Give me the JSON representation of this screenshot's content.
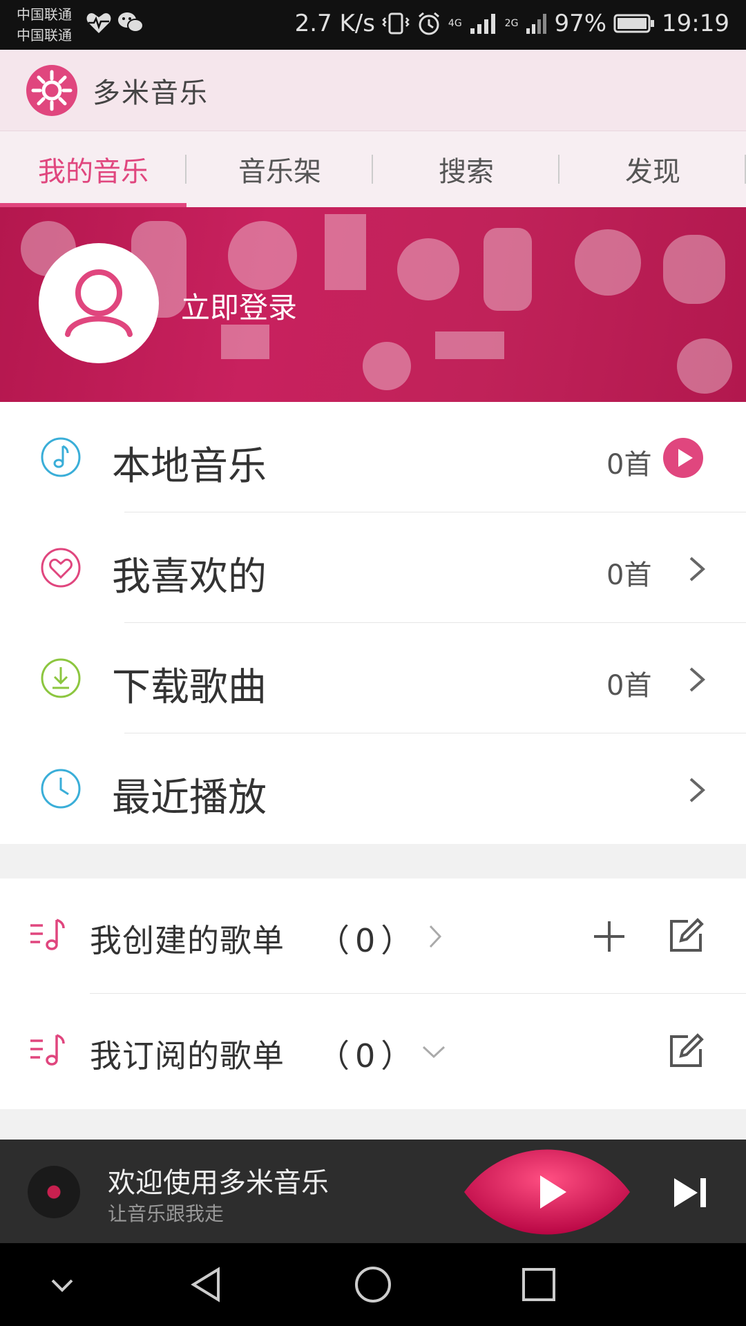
{
  "status_bar": {
    "carrier_1": "中国联通",
    "carrier_2": "中国联通",
    "net_speed": "2.7 K/s",
    "net_4g": "4G",
    "net_2g": "2G",
    "battery": "97%",
    "time": "19:19"
  },
  "app": {
    "title": "多米音乐",
    "accent_color": "#e0467e"
  },
  "tabs": [
    {
      "label": "我的音乐",
      "active": true
    },
    {
      "label": "音乐架",
      "active": false
    },
    {
      "label": "搜索",
      "active": false
    },
    {
      "label": "发现",
      "active": false
    }
  ],
  "banner": {
    "login_label": "立即登录"
  },
  "menu": [
    {
      "label": "本地音乐",
      "count": "0首",
      "icon": "music-note-icon",
      "action": "play-icon"
    },
    {
      "label": "我喜欢的",
      "count": "0首",
      "icon": "heart-icon",
      "action": "chevron-right-icon"
    },
    {
      "label": "下载歌曲",
      "count": "0首",
      "icon": "download-icon",
      "action": "chevron-right-icon"
    },
    {
      "label": "最近播放",
      "count": "",
      "icon": "clock-icon",
      "action": "chevron-right-icon"
    }
  ],
  "playlists": [
    {
      "label": "我创建的歌单",
      "count": "（0）",
      "toggle_icon": "chevron-right-icon",
      "actions": [
        "add-icon",
        "edit-icon"
      ]
    },
    {
      "label": "我订阅的歌单",
      "count": "（0）",
      "toggle_icon": "chevron-down-icon",
      "actions": [
        "edit-icon"
      ]
    }
  ],
  "player": {
    "title": "欢迎使用多米音乐",
    "subtitle": "让音乐跟我走"
  }
}
